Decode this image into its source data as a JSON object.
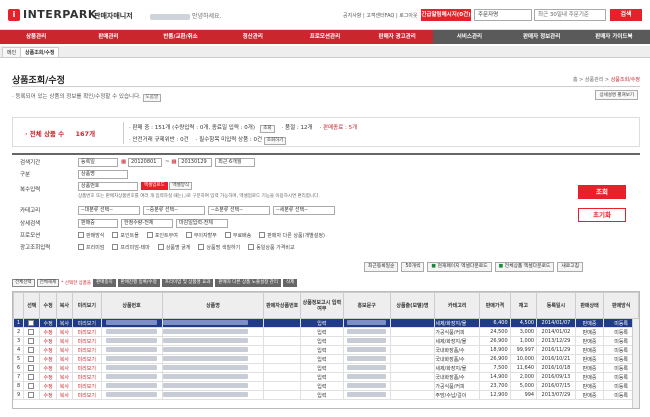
{
  "header": {
    "logo_text": "INTERPARK",
    "app_name": "판매자매니저",
    "greeting_suffix": "안녕하세요.",
    "top_links": "공지사항 | 고객센터FAQ | 로그아웃",
    "urgent_label": "긴급알림메시지(0건)",
    "order_select": "주문자명",
    "order_search_placeholder": "최근 30일내 주문기준",
    "search_label": "검색"
  },
  "nav": [
    "상품관리",
    "판매관리",
    "반품/교환/취소",
    "정산관리",
    "프로모션관리",
    "판매자 광고관리",
    "서비스관리",
    "판매자 정보관리",
    "판매자 가이드북"
  ],
  "tabs": {
    "main": "메인",
    "current": "상품조회/수정"
  },
  "page": {
    "title": "상품조회/수정",
    "breadcrumb_home": "홈",
    "breadcrumb_mid": "상품관리",
    "breadcrumb_current": "상품조회/수정",
    "guide_text": "등록되어 있는 상품의 정보를 확인/수정할 수 있습니다.",
    "guide_help": "도움말",
    "guide_btn": "상세설명 펼쳐보기"
  },
  "stats": {
    "total_label": "· 전체 상품 수",
    "total_value": "167개",
    "line1": "판매 중 : 151개 (수량입력 : 0개, 종료일 입력 : 0개)",
    "line1b": "품절 : 12개",
    "line1c": "판매종료 : 5개",
    "line1_btn": "조회",
    "line2": "안전거래 규제위반 : 0건",
    "line2b": "필수항목 미입력 상품 : 0건",
    "line2_btn": "조회하기"
  },
  "form": {
    "period_label": "검색기간",
    "period_type": "등록일",
    "date_from": "20120801",
    "date_to": "20130129",
    "period_preset": "최근 6개월",
    "category_label": "구분",
    "category_value": "상품명",
    "multi_label": "복수입력",
    "multi_value": "상품번호",
    "multi_hint": "상품번호 또는 판매자상품번호를 여러 개 입력하실 때는(,)로 구분하여 입력 가능하며, 엑셀업로드 기능을 이용하시면 편리합니다.",
    "excel_upload": "엑셀업로드",
    "excel_form": "엑셀양식",
    "cat_label": "카테고리",
    "cat1": "--대분류 선택--",
    "cat2": "--중분류 선택--",
    "cat3": "--소분류 선택--",
    "cat4": "--세분류 선택--",
    "status_label": "상세검색",
    "status1": "판매중",
    "status2": "한정수량-전체",
    "status3": "마감일입력-전체",
    "promo_label": "프로모션",
    "promo_opts": [
      "판매방식",
      "포인트몰",
      "포인트부여",
      "무이자할부",
      "무료배송",
      "판매자 다른 상품(개별설정)"
    ],
    "ad_label": "광고조회입력",
    "ad_opts": [
      "프리미엄",
      "프리미엄-테마",
      "상품명 굵게",
      "상품명 색칠하기",
      "동일상품 가격비교"
    ],
    "search_btn": "조회",
    "reset_btn": "초기화"
  },
  "toolbar": {
    "sort": "최근등록일순",
    "per_page": "50개씩",
    "excel_page": "현재페이지 엑셀다운로드",
    "excel_all": "전체상품 엑셀다운로드",
    "refresh": "새로고침"
  },
  "listbar": {
    "b1": "전체선택",
    "b2": "전체해제",
    "selected_text": "* 선택한 상품을",
    "b3": "판매중지",
    "b4": "판매진행 등록/수정",
    "b5": "프리미엄 및 상품명 효과",
    "b6": "판매자 다른 상품 노출설정 관리",
    "b7": "삭제"
  },
  "table": {
    "headers": [
      "",
      "선택",
      "수정",
      "복사",
      "미리보기",
      "상품번호",
      "상품명",
      "판매자상품번호",
      "상품정보고시 입력여부",
      "홍보문구",
      "상품출(모델)명",
      "카테고리",
      "판매가격",
      "재고",
      "등록일시",
      "판매상태",
      "판매방식"
    ],
    "rows": [
      {
        "n": "1",
        "edit": "수정",
        "copy": "복사",
        "pv": "미리보기",
        "info": "입력",
        "cat": "세제/화장지/물",
        "price": "6,400",
        "stock": "4,500",
        "date": "2014/01/07",
        "state": "판매중",
        "way": "미등록"
      },
      {
        "n": "2",
        "edit": "수정",
        "copy": "복사",
        "pv": "미리보기",
        "info": "입력",
        "cat": "가공식품/커피",
        "price": "24,500",
        "stock": "3,000",
        "date": "2014/01/02",
        "state": "판매중",
        "way": "미등록"
      },
      {
        "n": "3",
        "edit": "수정",
        "copy": "복사",
        "pv": "미리보기",
        "info": "입력",
        "cat": "세제/화장지/물",
        "price": "26,900",
        "stock": "1,000",
        "date": "2013/12/29",
        "state": "판매중",
        "way": "미등록"
      },
      {
        "n": "4",
        "edit": "수정",
        "copy": "복사",
        "pv": "미리보기",
        "info": "입력",
        "cat": "국내화장품/수",
        "price": "18,900",
        "stock": "99,997",
        "date": "2016/11/29",
        "state": "판매중",
        "way": "미등록"
      },
      {
        "n": "5",
        "edit": "수정",
        "copy": "복사",
        "pv": "미리보기",
        "info": "입력",
        "cat": "국내화장품/수",
        "price": "26,900",
        "stock": "10,000",
        "date": "2016/10/21",
        "state": "판매중",
        "way": "미등록"
      },
      {
        "n": "6",
        "edit": "수정",
        "copy": "복사",
        "pv": "미리보기",
        "info": "입력",
        "cat": "세제/화장지/물",
        "price": "7,500",
        "stock": "11,640",
        "date": "2016/10/18",
        "state": "판매중",
        "way": "미등록"
      },
      {
        "n": "7",
        "edit": "수정",
        "copy": "복사",
        "pv": "미리보기",
        "info": "입력",
        "cat": "국내화장품/수",
        "price": "14,900",
        "stock": "2,000",
        "date": "2016/09/13",
        "state": "판매중",
        "way": "미등록"
      },
      {
        "n": "8",
        "edit": "수정",
        "copy": "복사",
        "pv": "미리보기",
        "info": "입력",
        "cat": "가공식품/커피",
        "price": "23,700",
        "stock": "5,000",
        "date": "2016/07/15",
        "state": "판매중",
        "way": "미등록"
      },
      {
        "n": "9",
        "edit": "수정",
        "copy": "복사",
        "pv": "미리보기",
        "info": "입력",
        "cat": "주방/수납/걸이",
        "price": "12,900",
        "stock": "994",
        "date": "2013/07/29",
        "state": "판매중",
        "way": "미등록"
      }
    ]
  },
  "colors": {
    "brand_red": "#e6212a",
    "nav_red": "#c9262e",
    "nav_dark": "#5a5a5a",
    "selected_row": "#1f3b8a"
  }
}
